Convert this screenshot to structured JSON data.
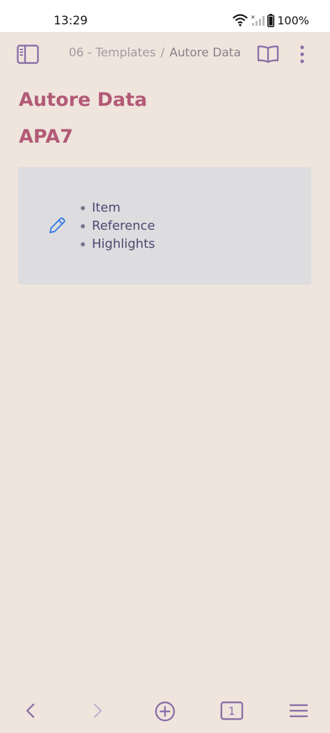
{
  "status_bar": {
    "time": "13:29",
    "battery": "100%",
    "icons": [
      "wifi-icon",
      "no-signal-icon",
      "battery-icon"
    ]
  },
  "header": {
    "breadcrumb_parent": "06 - Templates",
    "breadcrumb_separator": "/",
    "breadcrumb_current": "Autore Data",
    "icons": [
      "sidebar-toggle-icon",
      "reading-mode-icon",
      "more-options-icon"
    ]
  },
  "note": {
    "title": "Autore Data",
    "heading": "APA7",
    "callout_items": [
      "Item",
      "Reference",
      "Highlights"
    ],
    "icons": [
      "edit-pencil-icon"
    ]
  },
  "bottom_nav": {
    "tab_count": "1",
    "icons": [
      "back-icon",
      "forward-icon",
      "new-note-icon",
      "tabs-icon",
      "menu-icon"
    ]
  },
  "colors": {
    "background": "#efe5dc",
    "heading": "#b25a78",
    "icon": "#8a6fa8",
    "callout_bg": "#dddcdf",
    "list_text": "#4b4870",
    "accent_blue": "#3c7ee0"
  }
}
